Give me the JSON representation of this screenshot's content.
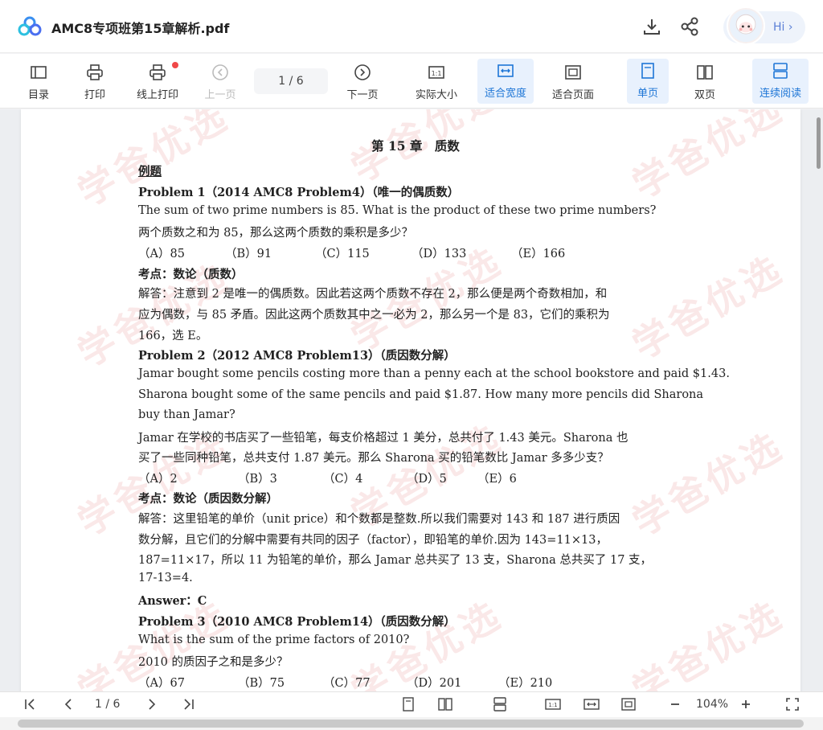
{
  "window": {
    "title": "AMC8专项班第15章解析.pdf",
    "hi_label": "Hi ›"
  },
  "toolbar": {
    "toc": "目录",
    "print": "打印",
    "online_print": "线上打印",
    "prev_page": "上一页",
    "page_indicator": "1 / 6",
    "next_page": "下一页",
    "actual_size": "实际大小",
    "fit_width": "适合宽度",
    "fit_page": "适合页面",
    "single_page": "单页",
    "double_page": "双页",
    "continuous": "连续阅读"
  },
  "watermark": {
    "text": "学爸优选"
  },
  "document": {
    "chapter_title": "第 15 章　质数",
    "section_label": "例题",
    "p1": {
      "title": "Problem 1（2014 AMC8 Problem4）（唯一的偶质数）",
      "en": "The sum of two prime numbers is 85. What is the product of these two prime numbers?",
      "zh": "两个质数之和为 85，那么这两个质数的乘积是多少？",
      "choices": [
        "（A）85",
        "（B）91",
        "（C）115",
        "（D）133",
        "（E）166"
      ],
      "topic": "考点：数论（质数）",
      "answer_lines": [
        "解答：注意到 2 是唯一的偶质数。因此若这两个质数不存在 2，那么便是两个奇数相加，和",
        "应为偶数，与 85 矛盾。因此这两个质数其中之一必为 2，那么另一个是 83，它们的乘积为",
        "166，选 E。"
      ]
    },
    "p2": {
      "title": "Problem 2（2012 AMC8 Problem13）（质因数分解）",
      "en_lines": [
        "Jamar bought some pencils costing more than a penny each at the school bookstore and paid $1.43.",
        "Sharona bought some of the same pencils and paid $1.87. How many more pencils did Sharona",
        "buy than Jamar?"
      ],
      "zh_lines": [
        "Jamar 在学校的书店买了一些铅笔，每支价格超过 1 美分，总共付了 1.43 美元。Sharona 也",
        "买了一些同种铅笔，总共支付 1.87 美元。那么 Sharona 买的铅笔数比 Jamar 多多少支？"
      ],
      "choices": [
        "（A）2",
        "（B）3",
        "（C）4",
        "（D）5",
        "（E）6"
      ],
      "topic": "考点：数论（质因数分解）",
      "answer_lines": [
        "解答：这里铅笔的单价（unit price）和个数都是整数.所以我们需要对 143 和 187 进行质因",
        "数分解，且它们的分解中需要有共同的因子（factor），即铅笔的单价.因为 143=11×13，",
        "187=11×17，所以 11 为铅笔的单价，那么 Jamar 总共买了 13 支，Sharona 总共买了 17 支，",
        "17-13=4."
      ],
      "final_answer": "Answer：C"
    },
    "p3": {
      "title": "Problem 3（2010 AMC8 Problem14）（质因数分解）",
      "en": "What is the sum of the prime factors of 2010?",
      "zh": "2010 的质因子之和是多少？",
      "choices": [
        "（A）67",
        "（B）75",
        "（C）77",
        "（D）201",
        "（E）210"
      ]
    }
  },
  "bottombar": {
    "page_indicator": "1 / 6",
    "zoom": "104%"
  },
  "colors": {
    "accent": "#1e76d6",
    "active_bg": "#e8f1fd",
    "notification": "#f04848"
  }
}
